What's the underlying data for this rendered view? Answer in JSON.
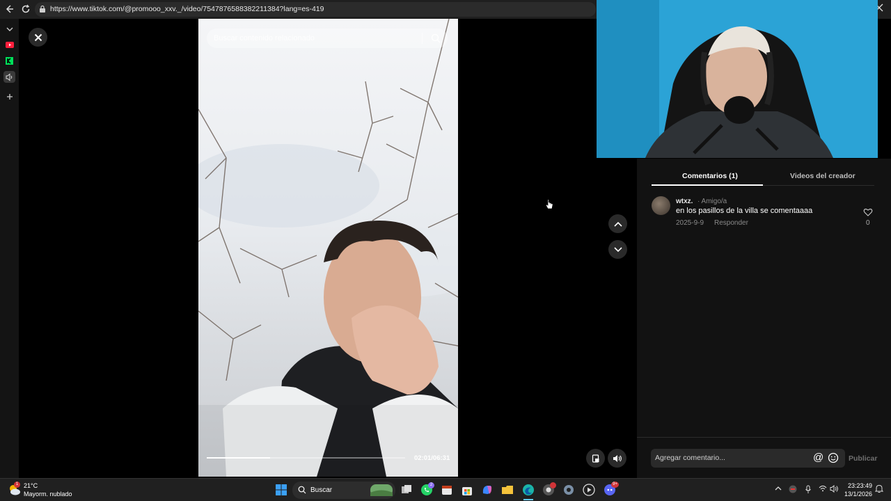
{
  "browser": {
    "url": "https://www.tiktok.com/@promooo_xxv._/video/7547876588382211384?lang=es-419",
    "icons": [
      "back-icon",
      "reload-icon",
      "lock-icon",
      "close-icon"
    ]
  },
  "sidebar": {
    "icons": [
      "chevron-down-icon",
      "youtube-icon",
      "kick-icon",
      "speaker-icon",
      "plus-icon"
    ]
  },
  "video": {
    "search_placeholder": "Buscar contenido relacionado",
    "timecode": "02:01/06:31",
    "progress": 0.32
  },
  "panel": {
    "tabs": [
      {
        "label": "Comentarios (1)",
        "active": true
      },
      {
        "label": "Videos del creador",
        "active": false
      }
    ],
    "comments": [
      {
        "user": "wtxz.",
        "relation": "· Amigo/a",
        "text": "en los pasillos de la villa se comentaaaa",
        "date": "2025-9-9",
        "reply_label": "Responder",
        "likes": "0"
      }
    ],
    "composer": {
      "placeholder": "Agregar comentario...",
      "at_symbol": "@",
      "publish_label": "Publicar"
    }
  },
  "taskbar": {
    "temperature": "21°C",
    "weather_desc": "Mayorm. nublado",
    "search_label": "Buscar",
    "time": "23:23:49",
    "date": "13/1/2026",
    "badges": {
      "whatsapp": "2",
      "discord": "9+",
      "weather": "1"
    }
  },
  "colors": {
    "background": "#000000",
    "panel": "#121212",
    "accent_tab_line": "#ffffff",
    "webcam_wall": "#2fa0d0"
  }
}
